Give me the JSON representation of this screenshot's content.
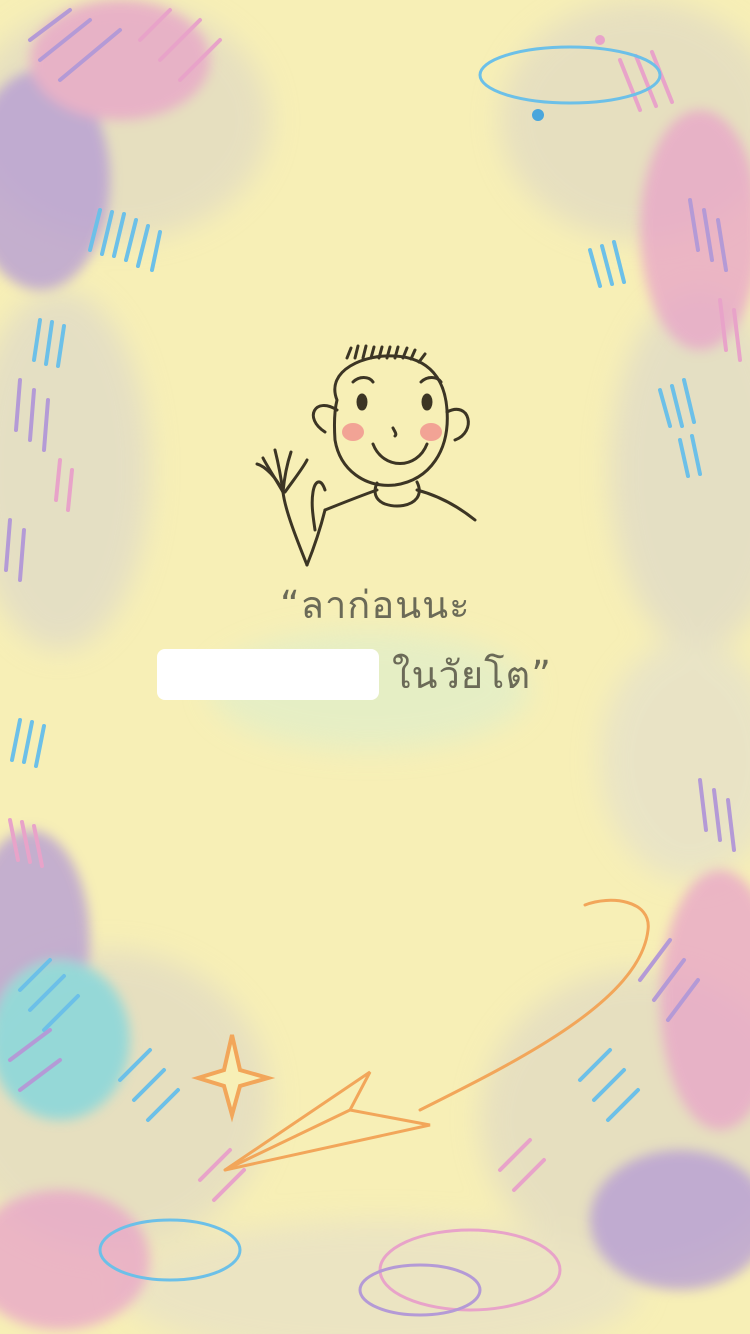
{
  "message": {
    "line1": "“ลาก่อนนะ",
    "line2": "ในวัยโต”"
  },
  "name_input": {
    "value": "",
    "placeholder": ""
  },
  "colors": {
    "background": "#f7efb6",
    "text": "#6b6a57",
    "accent_pink": "#e8a3c9",
    "accent_purple": "#b49ad6",
    "accent_blue": "#6cc0e8",
    "accent_orange": "#f2a65a"
  },
  "icons": [
    "waving-boy-illustration",
    "paper-plane-icon",
    "sparkle-icon"
  ]
}
